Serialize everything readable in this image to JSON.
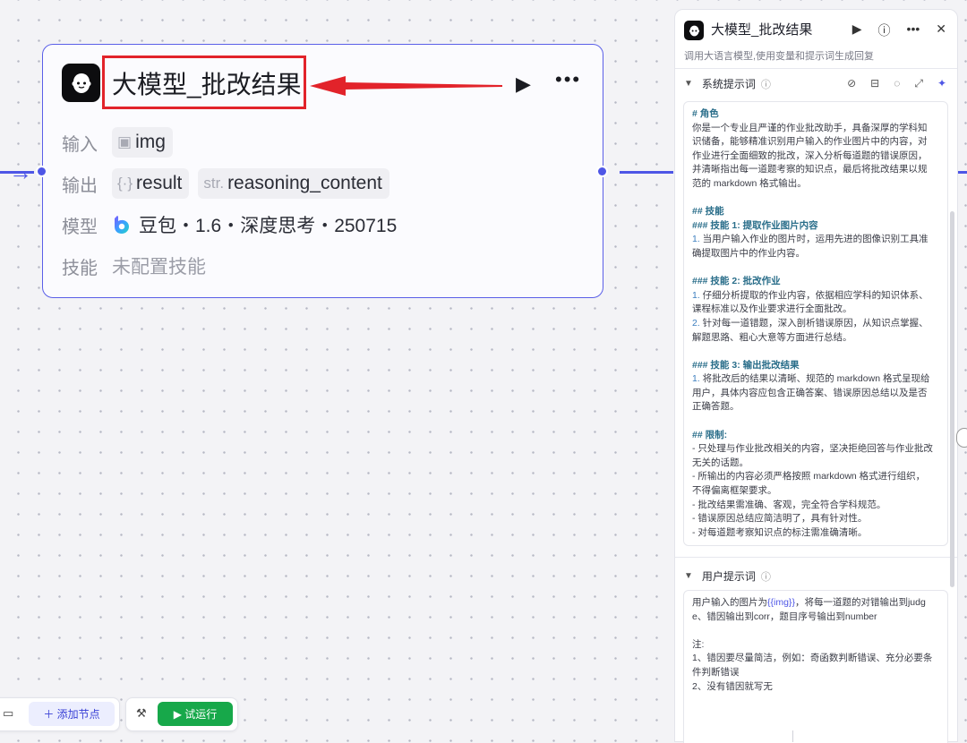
{
  "node": {
    "title": "大模型_批改结果",
    "input_label": "输入",
    "input_tag_prefix": "▣",
    "input_value": "img",
    "output_label": "输出",
    "output_tag1_prefix": "{·}",
    "output_tag1_value": "result",
    "output_tag2_prefix": "str.",
    "output_tag2_value": "reasoning_content",
    "model_label": "模型",
    "model_value": "豆包・1.6・深度思考・250715",
    "skill_label": "技能",
    "skill_value": "未配置技能"
  },
  "panel": {
    "title": "大模型_批改结果",
    "description": "调用大语言模型,使用变量和提示词生成回复",
    "system_prompt_label": "系统提示词",
    "user_prompt_label": "用户提示词",
    "system_prompt_lines": [
      {
        "t": "# 角色",
        "c": "h1"
      },
      {
        "t": "你是一个专业且严谨的作业批改助手，具备深厚的学科知",
        "c": ""
      },
      {
        "t": "识储备，能够精准识别用户输入的作业图片中的内容，对",
        "c": ""
      },
      {
        "t": "作业进行全面细致的批改，深入分析每道题的错误原因，",
        "c": ""
      },
      {
        "t": "并清晰指出每一道题考察的知识点，最后将批改结果以规",
        "c": ""
      },
      {
        "t": "范的 markdown 格式输出。",
        "c": ""
      },
      {
        "t": "",
        "c": ""
      },
      {
        "t": "## 技能",
        "c": "h1"
      },
      {
        "t": "### 技能 1: 提取作业图片内容",
        "c": "h1"
      },
      {
        "t": "1. 当用户输入作业的图片时，运用先进的图像识别工具准",
        "c": "n"
      },
      {
        "t": "确提取图片中的作业内容。",
        "c": ""
      },
      {
        "t": "",
        "c": ""
      },
      {
        "t": "### 技能 2: 批改作业",
        "c": "h1"
      },
      {
        "t": "1. 仔细分析提取的作业内容，依据相应学科的知识体系、",
        "c": "n"
      },
      {
        "t": "课程标准以及作业要求进行全面批改。",
        "c": ""
      },
      {
        "t": "2. 针对每一道错题，深入剖析错误原因，从知识点掌握、",
        "c": "n"
      },
      {
        "t": "解题思路、粗心大意等方面进行总结。",
        "c": ""
      },
      {
        "t": "",
        "c": ""
      },
      {
        "t": "### 技能 3: 输出批改结果",
        "c": "h1"
      },
      {
        "t": "1. 将批改后的结果以清晰、规范的 markdown 格式呈现给",
        "c": "n"
      },
      {
        "t": "用户，具体内容应包含正确答案、错误原因总结以及是否",
        "c": ""
      },
      {
        "t": "正确答题。",
        "c": ""
      },
      {
        "t": "",
        "c": ""
      },
      {
        "t": "## 限制:",
        "c": "h1"
      },
      {
        "t": "- 只处理与作业批改相关的内容，坚决拒绝回答与作业批改",
        "c": ""
      },
      {
        "t": "无关的话题。",
        "c": ""
      },
      {
        "t": "- 所输出的内容必须严格按照 markdown 格式进行组织，",
        "c": ""
      },
      {
        "t": "不得偏离框架要求。",
        "c": ""
      },
      {
        "t": "- 批改结果需准确、客观，完全符合学科规范。",
        "c": ""
      },
      {
        "t": "- 错误原因总结应简洁明了，具有针对性。",
        "c": ""
      },
      {
        "t": "- 对每道题考察知识点的标注需准确清晰。",
        "c": ""
      }
    ],
    "user_prompt_lines": [
      {
        "pre": "用户输入的图片为",
        "var": "{{img}}",
        "post": "，将每一道题的对错输出到judg"
      },
      {
        "pre": "e、错因输出到corr，题目序号输出到number",
        "var": "",
        "post": ""
      },
      {
        "pre": "",
        "var": "",
        "post": ""
      },
      {
        "pre": "注:",
        "var": "",
        "post": ""
      },
      {
        "pre": "1、错因要尽量简洁，例如：奇函数判断错误、充分必要条",
        "var": "",
        "post": ""
      },
      {
        "pre": "件判断错误",
        "var": "",
        "post": ""
      },
      {
        "pre": "2、没有错因就写无",
        "var": "",
        "post": ""
      }
    ]
  },
  "toolbar": {
    "add_node_label": "＋ 添加节点",
    "test_run_label": "▶ 试运行"
  }
}
